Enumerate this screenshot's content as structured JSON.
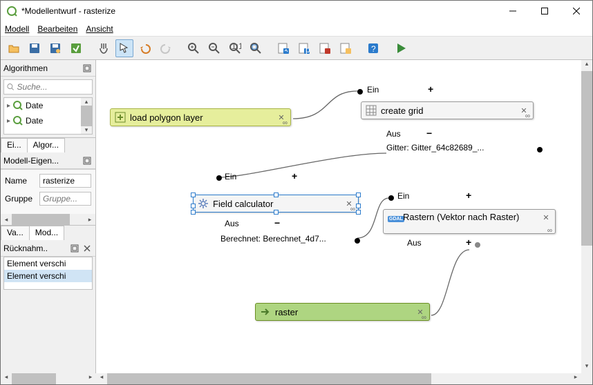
{
  "window": {
    "title": "*Modellentwurf - rasterize"
  },
  "menu": {
    "model": "Modell",
    "edit": "Bearbeiten",
    "view": "Ansicht"
  },
  "sidebar": {
    "algorithms_title": "Algorithmen",
    "search_placeholder": "Suche...",
    "tree_items": [
      "Date",
      "Date"
    ],
    "tabs": {
      "inputs": "Ei...",
      "algorithms": "Algor..."
    },
    "props_title": "Modell-Eigen...",
    "name_label": "Name",
    "name_value": "rasterize",
    "group_label": "Gruppe",
    "group_placeholder": "Gruppe...",
    "tabs2": {
      "variables": "Va...",
      "model": "Mod..."
    },
    "undo_title": "Rücknahm..",
    "undo_items": [
      "Element verschi",
      "Element verschi"
    ]
  },
  "nodes": {
    "load_polygon": {
      "label": "load polygon layer"
    },
    "create_grid": {
      "label": "create grid",
      "in": "Ein",
      "out": "Aus",
      "out_value": "Gitter: Gitter_64c82689_..."
    },
    "field_calc": {
      "label": "Field calculator",
      "in": "Ein",
      "out": "Aus",
      "out_value": "Berechnet: Berechnet_4d7..."
    },
    "rastern": {
      "label": "Rastern (Vektor nach Raster)",
      "in": "Ein",
      "out": "Aus"
    },
    "raster": {
      "label": "raster"
    }
  }
}
